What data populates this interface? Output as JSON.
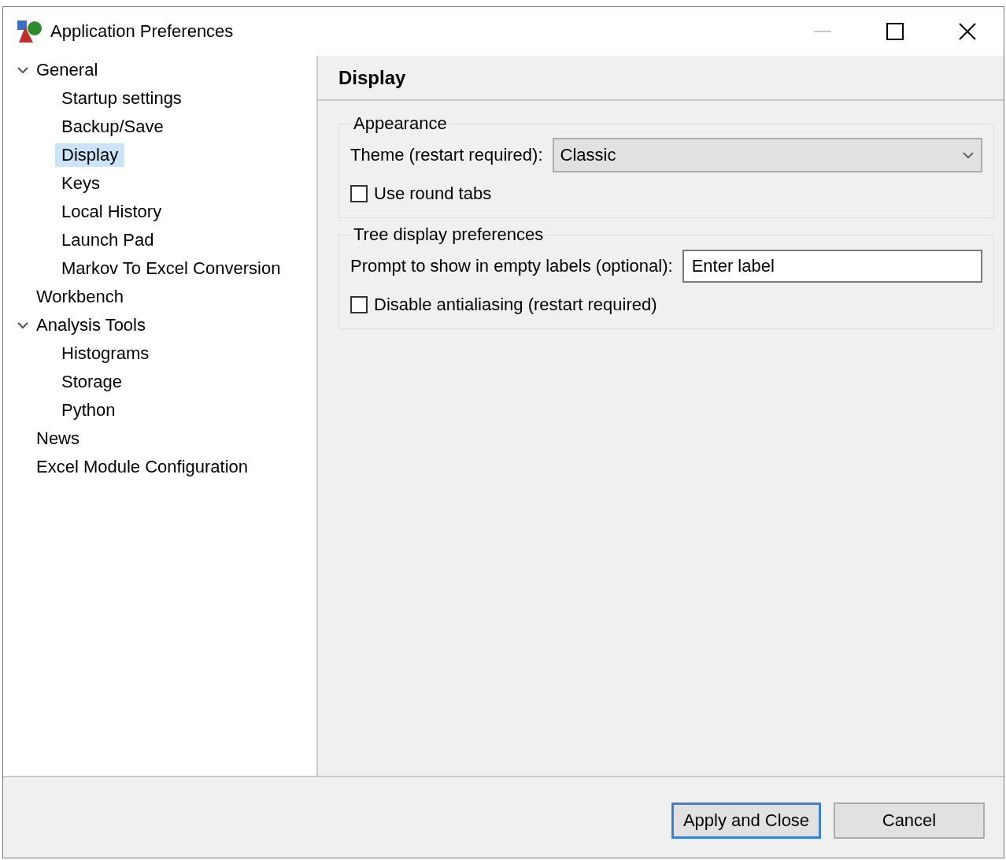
{
  "window": {
    "title": "Application Preferences",
    "minimize_enabled": false
  },
  "tree": [
    {
      "label": "General",
      "expanded": true,
      "selected": false,
      "children": [
        {
          "label": "Startup settings",
          "selected": false
        },
        {
          "label": "Backup/Save",
          "selected": false
        },
        {
          "label": "Display",
          "selected": true
        },
        {
          "label": "Keys",
          "selected": false
        },
        {
          "label": "Local History",
          "selected": false
        },
        {
          "label": "Launch Pad",
          "selected": false
        },
        {
          "label": "Markov To Excel Conversion",
          "selected": false
        }
      ]
    },
    {
      "label": "Workbench",
      "selected": false
    },
    {
      "label": "Analysis Tools",
      "expanded": true,
      "selected": false,
      "children": [
        {
          "label": "Histograms",
          "selected": false
        },
        {
          "label": "Storage",
          "selected": false
        },
        {
          "label": "Python",
          "selected": false
        }
      ]
    },
    {
      "label": "News",
      "selected": false
    },
    {
      "label": "Excel Module Configuration",
      "selected": false
    }
  ],
  "page": {
    "title": "Display",
    "groups": [
      {
        "title": "Appearance",
        "rows": [
          {
            "kind": "dropdown",
            "label": "Theme (restart required):",
            "value": "Classic"
          },
          {
            "kind": "checkbox",
            "label": "Use round tabs",
            "checked": false
          }
        ]
      },
      {
        "title": "Tree display preferences",
        "rows": [
          {
            "kind": "text",
            "label": "Prompt to show in empty labels (optional):",
            "value": "Enter label"
          },
          {
            "kind": "checkbox",
            "label": "Disable antialiasing (restart required)",
            "checked": false
          }
        ]
      }
    ]
  },
  "buttons": [
    {
      "label": "Apply and Close",
      "default": true
    },
    {
      "label": "Cancel",
      "default": false
    }
  ]
}
